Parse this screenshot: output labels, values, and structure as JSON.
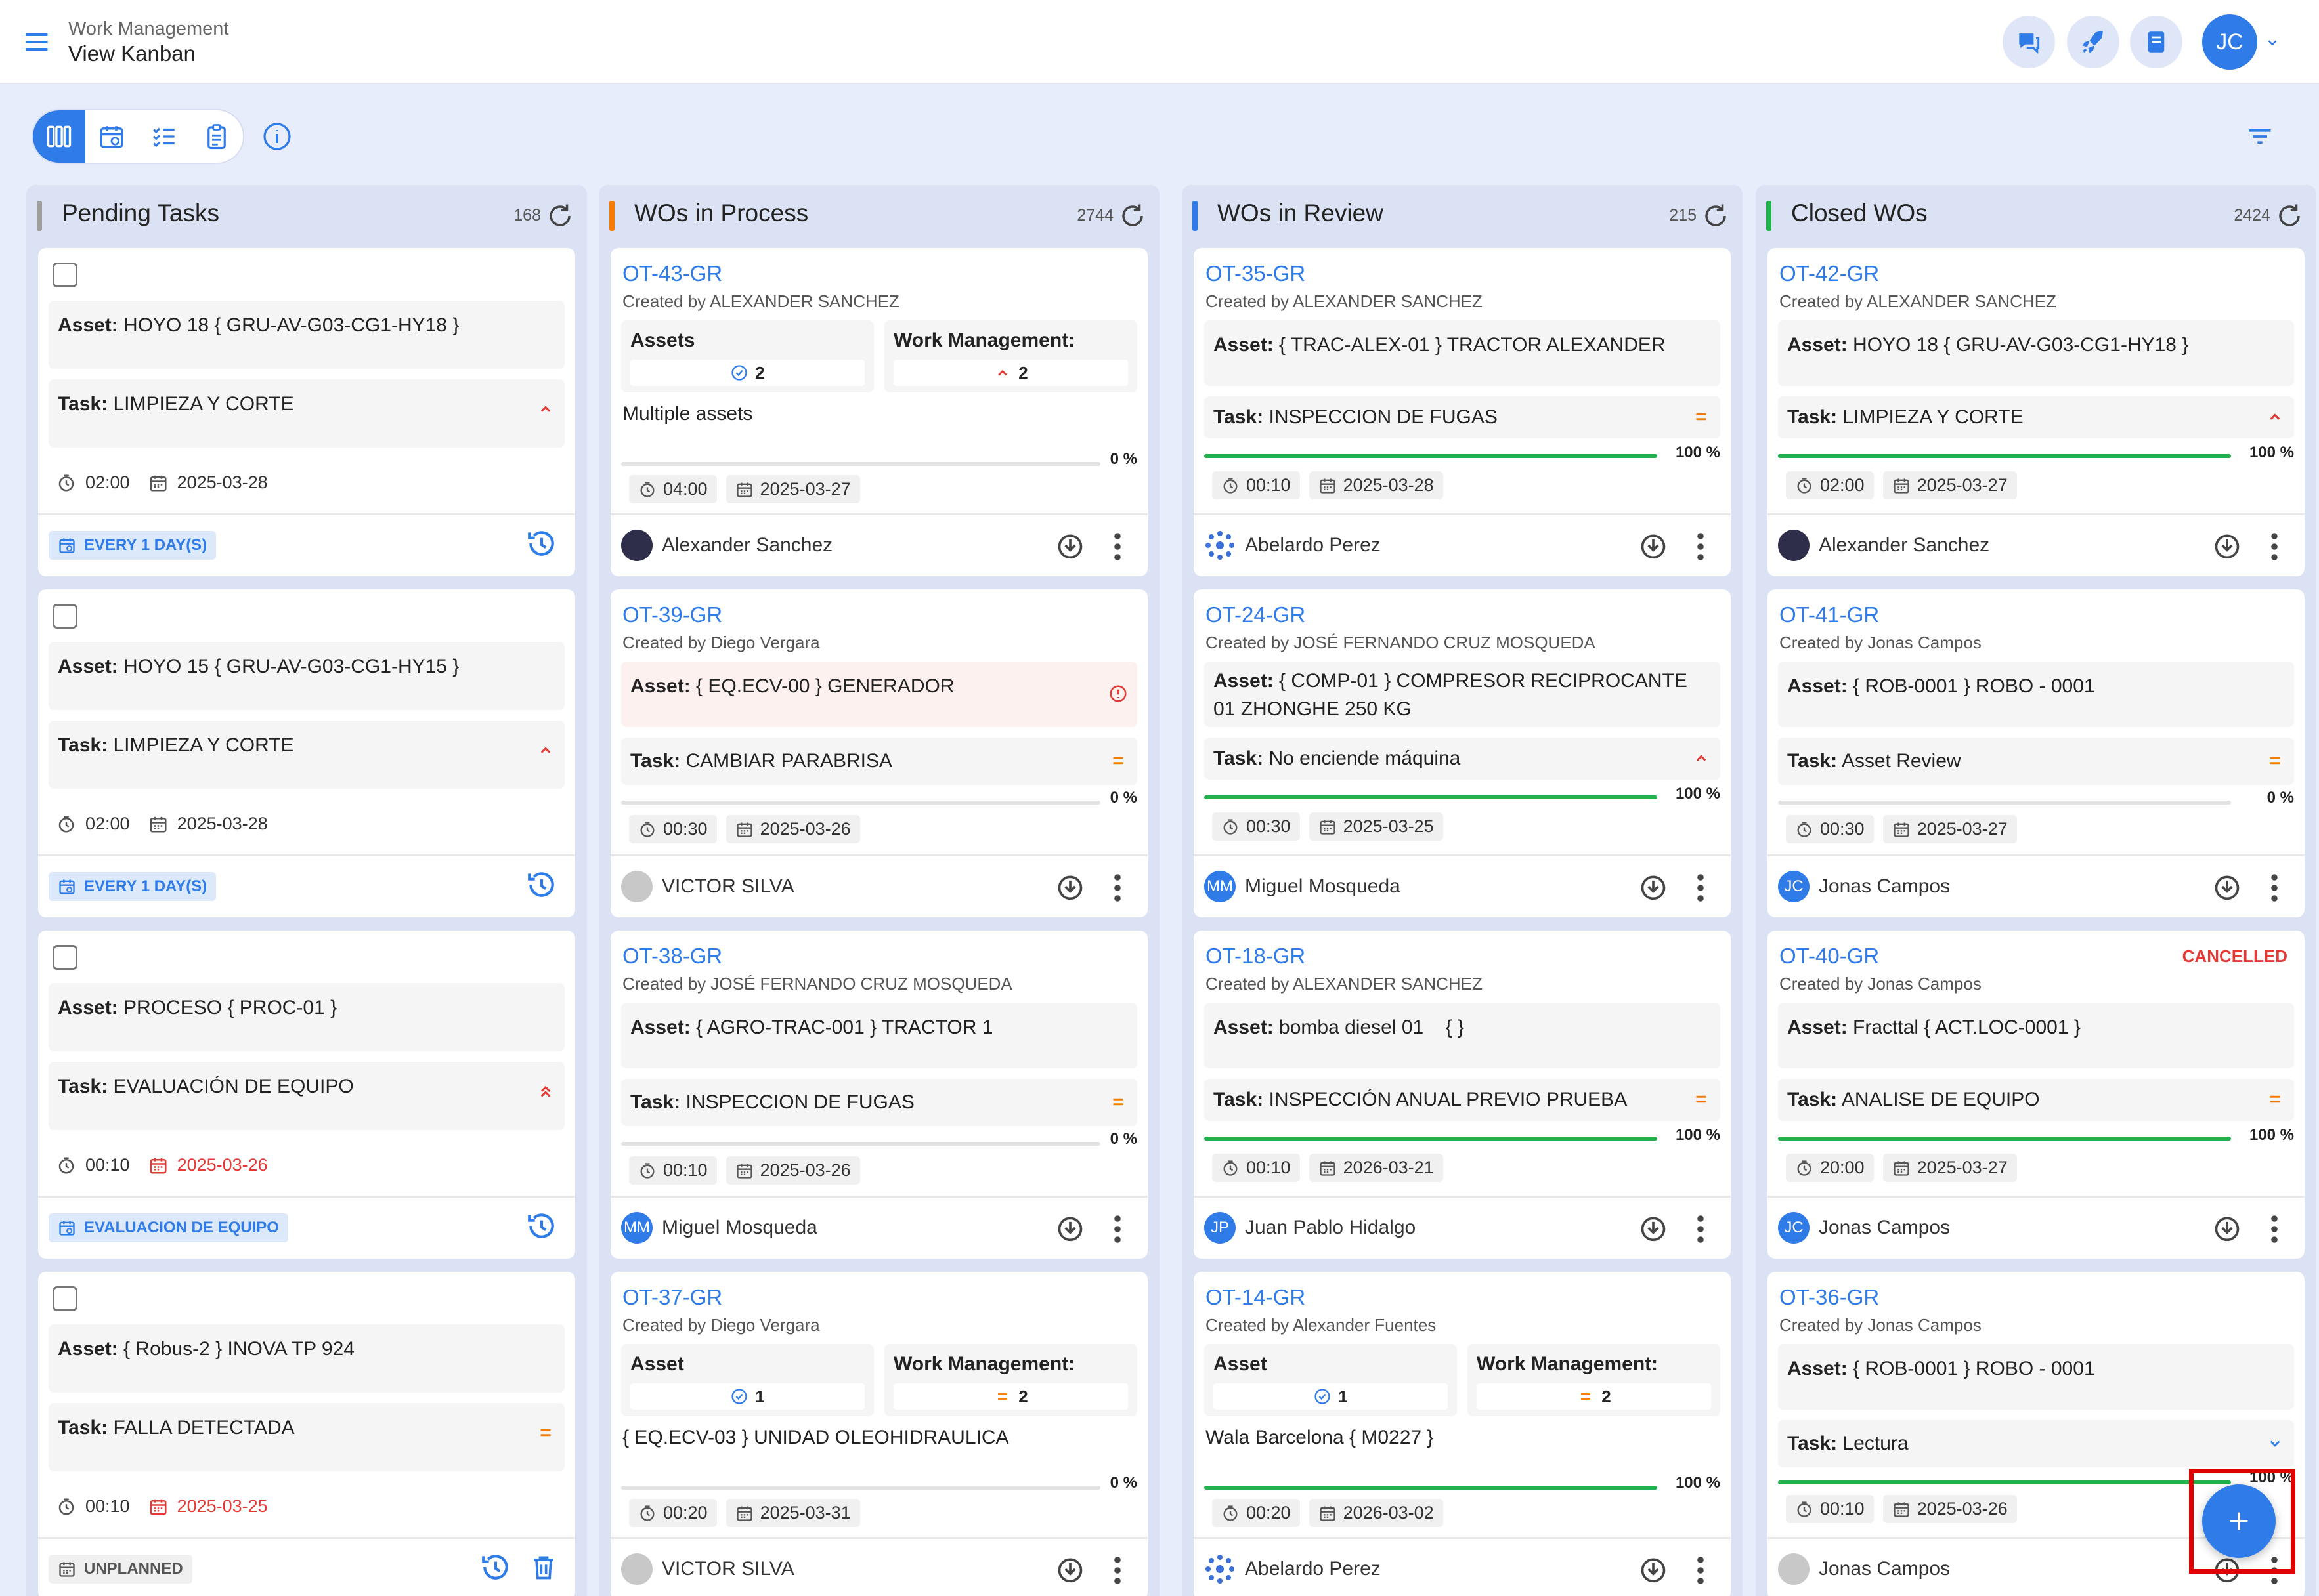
{
  "header": {
    "crumb_section": "Work Management",
    "crumb_page": "View Kanban",
    "user_initials": "JC"
  },
  "icons": [
    "menu-icon",
    "chat-icon",
    "rocket-icon",
    "book-icon",
    "chevron-down-icon",
    "kanban-icon",
    "calendar-icon",
    "list-check-icon",
    "clipboard-icon",
    "info-icon",
    "filter-icon",
    "refresh-icon",
    "clock-icon",
    "calendar-small-icon",
    "history-icon",
    "download-icon",
    "more-icon",
    "plus-icon"
  ],
  "colors": {
    "accent": "#2f7be8",
    "pending": "#9e9e9e",
    "process": "#f57c00",
    "review": "#2f7be8",
    "closed": "#22b14c",
    "danger": "#e53935",
    "progress": "#22b14c"
  },
  "columns": [
    {
      "title": "Pending Tasks",
      "count": "168"
    },
    {
      "title": "WOs in Process",
      "count": "2744"
    },
    {
      "title": "WOs in Review",
      "count": "215"
    },
    {
      "title": "Closed WOs",
      "count": "2424"
    }
  ],
  "labels": {
    "asset": "Asset:",
    "task": "Task:",
    "assets_title": "Assets",
    "asset_title": "Asset",
    "wm_title": "Work Management:",
    "cancelled": "CANCELLED"
  },
  "pending": [
    {
      "asset": "HOYO 18 { GRU-AV-G03-CG1-HY18 }",
      "task": "LIMPIEZA Y CORTE",
      "time": "02:00",
      "date": "2025-03-28",
      "freq": "EVERY 1 DAY(S)"
    },
    {
      "asset": "HOYO 15 { GRU-AV-G03-CG1-HY15 }",
      "task": "LIMPIEZA Y CORTE",
      "time": "02:00",
      "date": "2025-03-28",
      "freq": "EVERY 1 DAY(S)"
    },
    {
      "asset": "PROCESO { PROC-01 }",
      "task": "EVALUACIÓN DE EQUIPO",
      "time": "00:10",
      "date": "2025-03-26",
      "freq": "EVALUACION DE EQUIPO"
    },
    {
      "asset": "{ Robus-2 } INOVA TP 924",
      "task": "FALLA DETECTADA",
      "time": "00:10",
      "date": "2025-03-25",
      "freq": "UNPLANNED"
    }
  ],
  "process": [
    {
      "code": "OT-43-GR",
      "by": "Created by ALEXANDER SANCHEZ",
      "assets_count": "2",
      "wm_count": "2",
      "text": "Multiple assets",
      "progress": "0 %",
      "time": "04:00",
      "date": "2025-03-27",
      "assignee": "Alexander Sanchez"
    },
    {
      "code": "OT-39-GR",
      "by": "Created by Diego Vergara",
      "asset": "{ EQ.ECV-00 } GENERADOR",
      "task": "CAMBIAR PARABRISA",
      "progress": "0 %",
      "time": "00:30",
      "date": "2025-03-26",
      "assignee": "VICTOR SILVA"
    },
    {
      "code": "OT-38-GR",
      "by": "Created by JOSÉ FERNANDO CRUZ MOSQUEDA",
      "asset": "{ AGRO-TRAC-001 } TRACTOR 1",
      "task": "INSPECCION DE FUGAS",
      "progress": "0 %",
      "time": "00:10",
      "date": "2025-03-26",
      "assignee": "Miguel Mosqueda",
      "initials": "MM"
    },
    {
      "code": "OT-37-GR",
      "by": "Created by Diego Vergara",
      "assets_count": "1",
      "wm_count": "2",
      "text": "{ EQ.ECV-03 } UNIDAD OLEOHIDRAULICA",
      "progress": "0 %",
      "time": "00:20",
      "date": "2025-03-31",
      "assignee": "VICTOR SILVA"
    }
  ],
  "review": [
    {
      "code": "OT-35-GR",
      "by": "Created by ALEXANDER SANCHEZ",
      "asset": "{ TRAC-ALEX-01 } TRACTOR ALEXANDER",
      "task": "INSPECCION DE FUGAS",
      "progress": "100 %",
      "time": "00:10",
      "date": "2025-03-28",
      "assignee": "Abelardo Perez"
    },
    {
      "code": "OT-24-GR",
      "by": "Created by JOSÉ FERNANDO CRUZ MOSQUEDA",
      "asset": "{ COMP-01 } COMPRESOR RECIPROCANTE 01 ZHONGHE 250 KG",
      "task": "No enciende máquina",
      "progress": "100 %",
      "time": "00:30",
      "date": "2025-03-25",
      "assignee": "Miguel Mosqueda",
      "initials": "MM"
    },
    {
      "code": "OT-18-GR",
      "by": "Created by ALEXANDER SANCHEZ",
      "asset": "bomba diesel 01    { }",
      "task": "INSPECCIÓN ANUAL PREVIO PRUEBA",
      "progress": "100 %",
      "time": "00:10",
      "date": "2026-03-21",
      "assignee": "Juan Pablo Hidalgo",
      "initials": "JP"
    },
    {
      "code": "OT-14-GR",
      "by": "Created by Alexander Fuentes",
      "assets_count": "1",
      "wm_count": "2",
      "text": "Wala Barcelona { M0227 }",
      "progress": "100 %",
      "time": "00:20",
      "date": "2026-03-02",
      "assignee": "Abelardo Perez"
    }
  ],
  "closed": [
    {
      "code": "OT-42-GR",
      "by": "Created by ALEXANDER SANCHEZ",
      "asset": "HOYO 18 { GRU-AV-G03-CG1-HY18 }",
      "task": "LIMPIEZA Y CORTE",
      "progress": "100 %",
      "time": "02:00",
      "date": "2025-03-27",
      "assignee": "Alexander Sanchez"
    },
    {
      "code": "OT-41-GR",
      "by": "Created by Jonas Campos",
      "asset": "{ ROB-0001 } ROBO - 0001",
      "task": "Asset Review",
      "progress": "0 %",
      "time": "00:30",
      "date": "2025-03-27",
      "assignee": "Jonas Campos",
      "initials": "JC"
    },
    {
      "code": "OT-40-GR",
      "by": "Created by Jonas Campos",
      "asset": "Fracttal { ACT.LOC-0001 }",
      "task": "ANALISE DE EQUIPO",
      "progress": "100 %",
      "time": "20:00",
      "date": "2025-03-27",
      "assignee": "Jonas Campos",
      "initials": "JC"
    },
    {
      "code": "OT-36-GR",
      "by": "Created by Jonas Campos",
      "asset": "{ ROB-0001 } ROBO - 0001",
      "task": "Lectura",
      "progress": "100 %",
      "time": "00:10",
      "date": "2025-03-26",
      "assignee": "Jonas Campos"
    }
  ]
}
